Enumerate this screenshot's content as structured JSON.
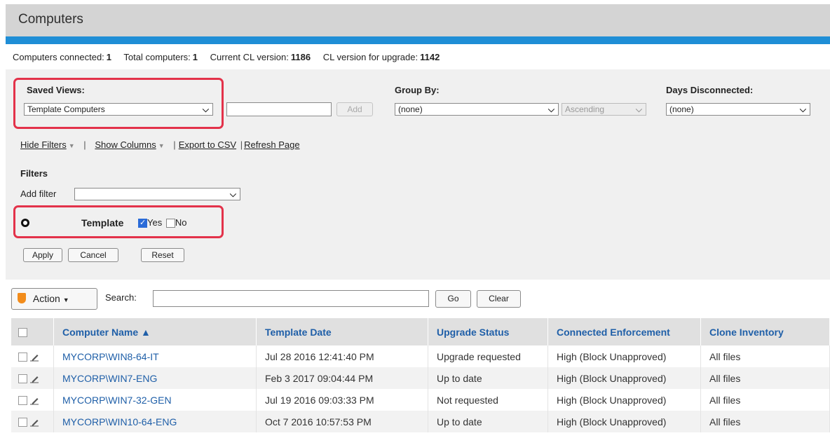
{
  "header": {
    "title": "Computers"
  },
  "stats": [
    {
      "label": "Computers connected:",
      "value": "1"
    },
    {
      "label": "Total computers:",
      "value": "1"
    },
    {
      "label": "Current CL version:",
      "value": "1186"
    },
    {
      "label": "CL version for upgrade:",
      "value": "1142"
    }
  ],
  "saved_views": {
    "label": "Saved Views:",
    "selected": "Template Computers",
    "new_view_value": "",
    "add_label": "Add"
  },
  "group_by": {
    "label": "Group By:",
    "selected": "(none)",
    "order": "Ascending"
  },
  "days_disconnected": {
    "label": "Days Disconnected:",
    "selected": "(none)"
  },
  "toolbar_links": {
    "hide_filters": "Hide Filters",
    "show_columns": "Show Columns",
    "export_csv": "Export to CSV",
    "refresh": "Refresh Page",
    "sep": "|"
  },
  "filters": {
    "title": "Filters",
    "add_filter_label": "Add filter",
    "add_filter_value": "",
    "template_label": "Template",
    "yes_label": "Yes",
    "no_label": "No",
    "yes_checked": true,
    "no_checked": false,
    "apply": "Apply",
    "cancel": "Cancel",
    "reset": "Reset"
  },
  "action_bar": {
    "action_label": "Action",
    "search_label": "Search:",
    "search_value": "",
    "go": "Go",
    "clear": "Clear"
  },
  "table": {
    "columns": [
      "Computer Name ▲",
      "Template Date",
      "Upgrade Status",
      "Connected Enforcement",
      "Clone Inventory"
    ],
    "rows": [
      [
        "MYCORP\\WIN8-64-IT",
        "Jul 28 2016 12:41:40 PM",
        "Upgrade requested",
        "High (Block Unapproved)",
        "All files"
      ],
      [
        "MYCORP\\WIN7-ENG",
        "Feb 3 2017 09:04:44 PM",
        "Up to date",
        "High (Block Unapproved)",
        "All files"
      ],
      [
        "MYCORP\\WIN7-32-GEN",
        "Jul 19 2016 09:03:33 PM",
        "Not requested",
        "High (Block Unapproved)",
        "All files"
      ],
      [
        "MYCORP\\WIN10-64-ENG",
        "Oct 7 2016 10:57:53 PM",
        "Up to date",
        "High (Block Unapproved)",
        "All files"
      ]
    ]
  },
  "colors": {
    "accent_blue": "#1f8ed6",
    "highlight_red": "#e3324a",
    "link_blue": "#1f5fa8",
    "action_icon": "#f28c1b"
  }
}
